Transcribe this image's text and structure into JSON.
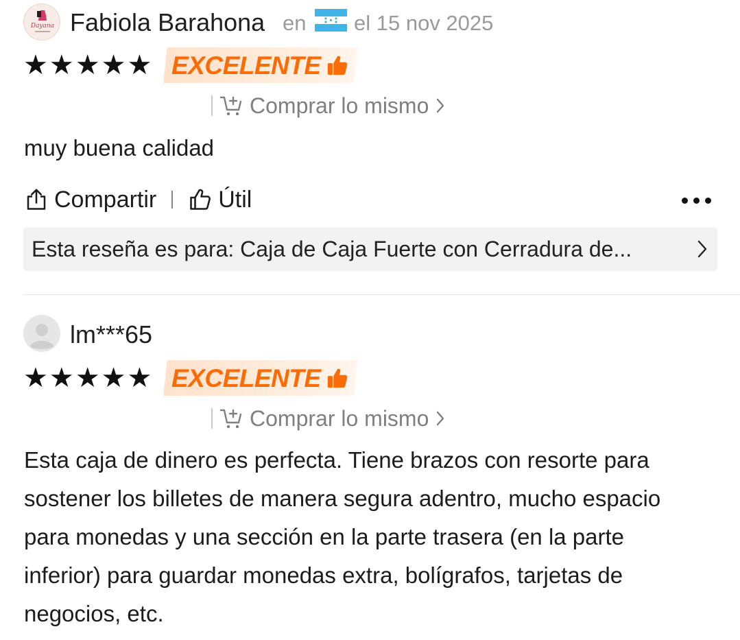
{
  "reviews": [
    {
      "username": "Fabiola Barahona",
      "location_prefix": "en",
      "country_flag": "Honduras",
      "date": "el 15 nov 2025",
      "stars": 5,
      "rating_label": "EXCELENTE",
      "buy_same_label": "Comprar lo mismo",
      "text": "muy buena calidad",
      "share_label": "Compartir",
      "helpful_label": "Útil",
      "product_label": "Esta reseña es para: Caja de Caja Fuerte con Cerradura de..."
    },
    {
      "username": "lm***65",
      "stars": 5,
      "rating_label": "EXCELENTE",
      "buy_same_label": "Comprar lo mismo",
      "text": "Esta caja de dinero es perfecta. Tiene brazos con resorte para sostener los billetes de manera segura adentro, mucho espacio para monedas y una sección en la parte trasera (en la parte inferior) para guardar monedas extra, bolígrafos, tarjetas de negocios, etc."
    }
  ],
  "colors": {
    "badge_orange": "#fb6b06",
    "badge_bg": "#ffe2cc",
    "muted_text": "#9a9a9a",
    "product_bar_bg": "#f2f2f2",
    "flag_blue": "#3fb4e6"
  },
  "icons": [
    "share-icon",
    "thumbs-up-icon",
    "cart-add-icon",
    "chevron-right-icon",
    "more-dots-icon",
    "default-avatar-icon",
    "store-logo-avatar"
  ]
}
